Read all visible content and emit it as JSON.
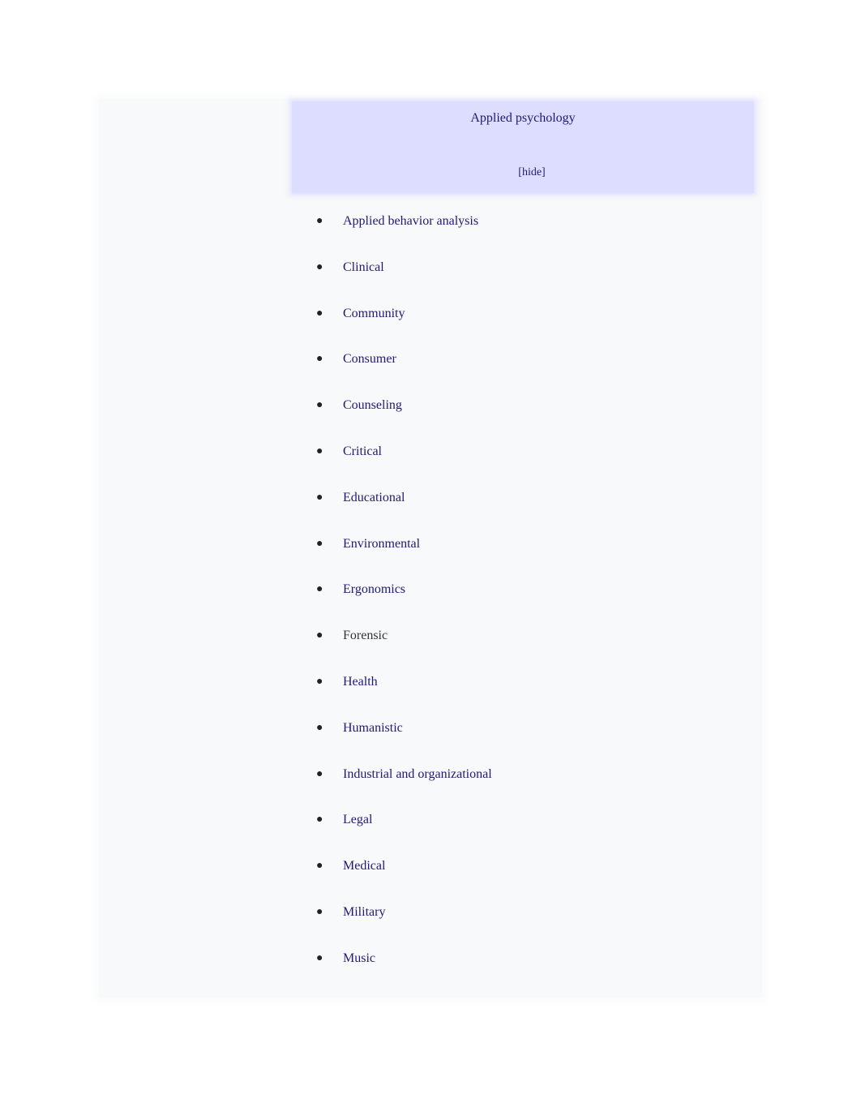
{
  "navbox": {
    "title": "Applied psychology",
    "hide_label": "[hide]",
    "colors": {
      "background": "#f8f9fa",
      "title_background": "#ddddff",
      "link": "#1e1a74",
      "plain_text": "#333333"
    },
    "bullet": "●",
    "items": [
      {
        "label": "Applied behavior analysis",
        "link": true
      },
      {
        "label": "Clinical",
        "link": true
      },
      {
        "label": "Community",
        "link": true
      },
      {
        "label": "Consumer",
        "link": true
      },
      {
        "label": "Counseling",
        "link": true
      },
      {
        "label": "Critical",
        "link": true
      },
      {
        "label": "Educational",
        "link": true
      },
      {
        "label": "Environmental",
        "link": true
      },
      {
        "label": "Ergonomics",
        "link": true
      },
      {
        "label": "Forensic",
        "link": false
      },
      {
        "label": "Health",
        "link": true
      },
      {
        "label": "Humanistic",
        "link": true
      },
      {
        "label": "Industrial and organizational",
        "link": true
      },
      {
        "label": "Legal",
        "link": true
      },
      {
        "label": "Medical",
        "link": true
      },
      {
        "label": "Military",
        "link": true
      },
      {
        "label": "Music",
        "link": true
      }
    ]
  }
}
